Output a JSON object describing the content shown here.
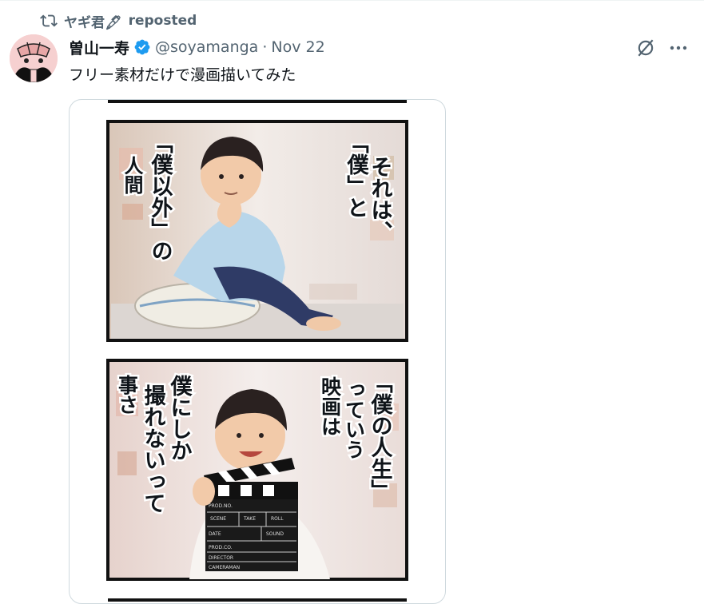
{
  "repost": {
    "user": "ヤギ君🖋",
    "label": "reposted",
    "icon": "repost-icon"
  },
  "tweet": {
    "display_name": "曽山一寿",
    "verified_icon": "verified-badge-icon",
    "handle": "@soyamanga",
    "separator": "·",
    "date": "Nov 22",
    "text": "フリー素材だけで漫画描いてみた"
  },
  "actions": {
    "grok_icon": "grok-icon",
    "more_icon": "more-icon"
  },
  "media": {
    "panel1": {
      "right_lines": [
        "それは、",
        "「僕」と"
      ],
      "left_lines": [
        "「僕以外」の",
        "人間"
      ]
    },
    "panel2": {
      "right_lines": [
        "「僕の人生」",
        "っていう",
        "映画は"
      ],
      "left_lines": [
        "僕にしか",
        "撮れないって",
        "事さ"
      ],
      "clapper": {
        "prod_no": "PROD.NO.",
        "scene": "SCENE",
        "take": "TAKE",
        "roll": "ROLL",
        "date": "DATE",
        "sound": "SOUND",
        "prod_co": "PROD.CO.",
        "director": "DIRECTOR",
        "cameraman": "CAMERAMAN"
      }
    }
  },
  "colors": {
    "verified_blue": "#1d9bf0",
    "secondary_text": "#536471",
    "border": "#cfd9de"
  }
}
